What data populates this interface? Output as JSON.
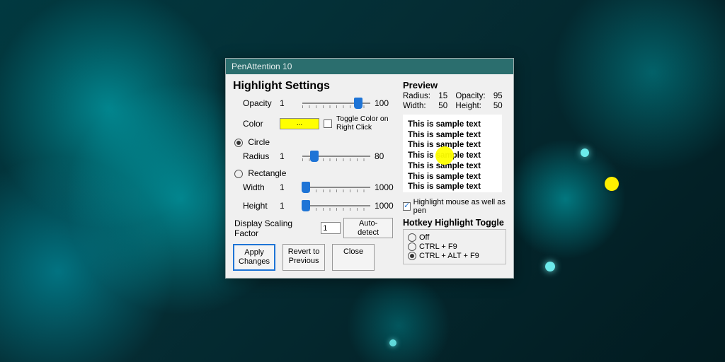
{
  "window": {
    "title": "PenAttention 10"
  },
  "header": "Highlight Settings",
  "opacity": {
    "label": "Opacity",
    "min": "1",
    "max": "100",
    "thumb_pct": 82
  },
  "color": {
    "label": "Color",
    "swatch_text": "...",
    "swatch_hex": "#ffff00",
    "toggle_label": "Toggle Color on Right Click",
    "toggle_checked": false
  },
  "circle": {
    "label": "Circle",
    "selected": true,
    "radius": {
      "label": "Radius",
      "min": "1",
      "max": "80",
      "thumb_pct": 18
    }
  },
  "rect": {
    "label": "Rectangle",
    "selected": false,
    "width": {
      "label": "Width",
      "min": "1",
      "max": "1000",
      "thumb_pct": 5
    },
    "height": {
      "label": "Height",
      "min": "1",
      "max": "1000",
      "thumb_pct": 5
    }
  },
  "dsf": {
    "label": "Display Scaling Factor",
    "value": "1",
    "auto_label": "Auto-detect"
  },
  "buttons": {
    "apply": "Apply\nChanges",
    "revert": "Revert to\nPrevious",
    "close": "Close"
  },
  "preview": {
    "title": "Preview",
    "radius_label": "Radius:",
    "radius_value": "15",
    "opacity_label": "Opacity:",
    "opacity_value": "95",
    "width_label": "Width:",
    "width_value": "50",
    "height_label": "Height:",
    "height_value": "50",
    "sample_line": "This is sample text",
    "highlight_hex": "#ffff00"
  },
  "highlight_mouse": {
    "label": "Highlight mouse as well as pen",
    "checked": true
  },
  "hotkey": {
    "title": "Hotkey Highlight Toggle",
    "options": [
      {
        "label": "Off",
        "checked": false
      },
      {
        "label": "CTRL + F9",
        "checked": false
      },
      {
        "label": "CTRL + ALT + F9",
        "checked": true
      }
    ]
  }
}
